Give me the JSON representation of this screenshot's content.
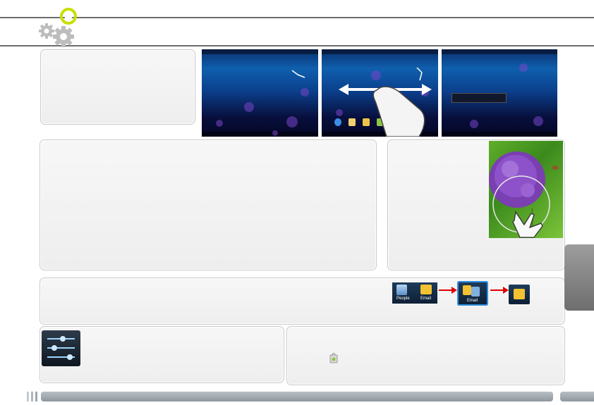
{
  "header": {
    "icon": "settings-gears-icon",
    "accent_color": "#c6e000"
  },
  "screenshots": [
    {
      "name": "home-screen",
      "gesture": "none"
    },
    {
      "name": "swipe-screen",
      "gesture": "swipe-left-right"
    },
    {
      "name": "menu-screen",
      "gesture": "none"
    }
  ],
  "folder_demo": {
    "app1_label": "People",
    "app2_label": "Email",
    "folder_label": "Email",
    "arrow_color": "#e00000"
  },
  "photo": {
    "subject": "purple allium flower",
    "gesture": "pinch-zoom"
  },
  "side_tab": {
    "color": "#7d7d7d"
  }
}
